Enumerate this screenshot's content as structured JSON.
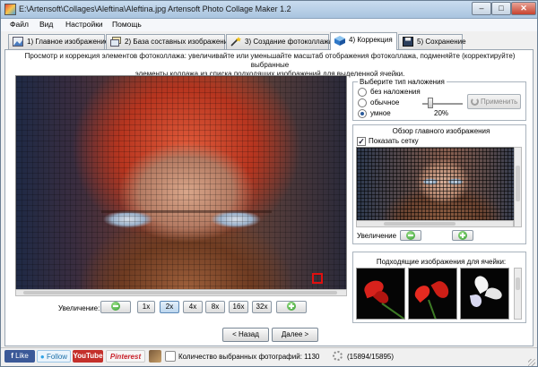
{
  "window": {
    "title": "E:\\Artensoft\\Collages\\Aleftina\\Aleftina.jpg Artensoft Photo Collage Maker 1.2"
  },
  "menu": [
    "Файл",
    "Вид",
    "Настройки",
    "Помощь"
  ],
  "tabs": [
    {
      "label": "1) Главное изображение"
    },
    {
      "label": "2) База составных изображений"
    },
    {
      "label": "3) Создание фотоколлажа"
    },
    {
      "label": "4) Коррекция"
    },
    {
      "label": "5) Сохранение"
    }
  ],
  "active_tab": "4) Коррекция",
  "description": {
    "line1": "Просмотр и коррекция элементов фотоколлажа: увеличивайте или уменьшайте масштаб отображения фотоколлажа, подменяйте (корректируйте) выбранные",
    "line2": "элементы коллажа из списка подходящих изображений для выделенной ячейки."
  },
  "zoom": {
    "label": "Увеличение:",
    "levels": [
      "1x",
      "2x",
      "4x",
      "8x",
      "16x",
      "32x"
    ],
    "selected": "2x"
  },
  "overlay": {
    "title": "Выберите тип наложения",
    "options": [
      "без наложения",
      "обычное",
      "умное"
    ],
    "selected": "умное",
    "strength_label": "20%",
    "strength_value": 20,
    "apply_label": "Применить"
  },
  "overview": {
    "title": "Обзор главного изображения",
    "show_grid_label": "Показать сетку",
    "show_grid": true,
    "zoom_label": "Увеличение"
  },
  "matches": {
    "title": "Подходящие изображения для ячейки:"
  },
  "nav": {
    "back_label": "< Назад",
    "next_label": "Далее >"
  },
  "status": {
    "like_label": "Like",
    "follow_label": "Follow",
    "youtube_label": "YouTube",
    "pinterest_label": "Pinterest",
    "selected_photos": "Количество выбранных фотографий: 1130",
    "progress": "(15894/15895)"
  },
  "colors": {
    "titlebar": "#a9c4df",
    "window_bg": "#f0f0f0",
    "selection_accent": "#5a88b6",
    "cell_marker": "#e01010",
    "zoom_icon": "#2f9a2a"
  }
}
